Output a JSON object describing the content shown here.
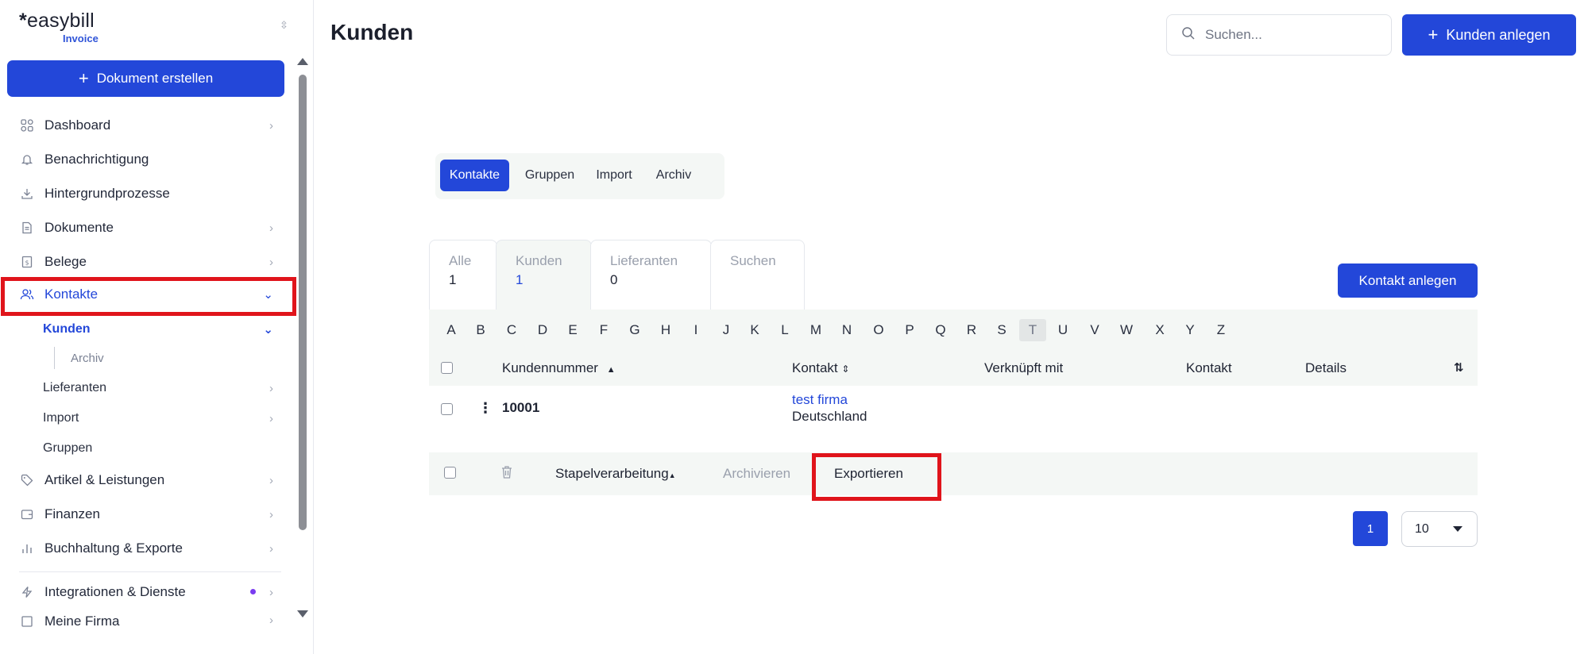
{
  "app": {
    "logo": "easybill",
    "logo_star": "*",
    "logo_sub": "Invoice",
    "collapse_icon": "chevron-up-down"
  },
  "sidebar": {
    "create_button": "Dokument erstellen",
    "items": [
      {
        "label": "Dashboard",
        "icon": "grid-icon"
      },
      {
        "label": "Benachrichtigung",
        "icon": "bell-icon"
      },
      {
        "label": "Hintergrundprozesse",
        "icon": "download-icon"
      },
      {
        "label": "Dokumente",
        "icon": "document-icon"
      },
      {
        "label": "Belege",
        "icon": "receipt-icon"
      },
      {
        "label": "Kontakte",
        "icon": "users-icon"
      },
      {
        "label": "Artikel & Leistungen",
        "icon": "tag-icon"
      },
      {
        "label": "Finanzen",
        "icon": "wallet-icon"
      },
      {
        "label": "Buchhaltung & Exporte",
        "icon": "bar-chart-icon"
      },
      {
        "label": "Integrationen & Dienste",
        "icon": "bolt-icon"
      },
      {
        "label": "Meine Firma",
        "icon": "building-icon"
      }
    ],
    "sub_items": [
      {
        "label": "Kunden"
      },
      {
        "label": "Archiv"
      },
      {
        "label": "Lieferanten"
      },
      {
        "label": "Import"
      },
      {
        "label": "Gruppen"
      }
    ]
  },
  "header": {
    "title": "Kunden",
    "search_placeholder": "Suchen...",
    "add_customer": "Kunden anlegen"
  },
  "segments": [
    "Kontakte",
    "Gruppen",
    "Import",
    "Archiv"
  ],
  "tabs": [
    {
      "label": "Alle",
      "count": "1"
    },
    {
      "label": "Kunden",
      "count": "1"
    },
    {
      "label": "Lieferanten",
      "count": "0"
    },
    {
      "label": "Suchen",
      "count": ""
    }
  ],
  "add_contact": "Kontakt anlegen",
  "letters": [
    "A",
    "B",
    "C",
    "D",
    "E",
    "F",
    "G",
    "H",
    "I",
    "J",
    "K",
    "L",
    "M",
    "N",
    "O",
    "P",
    "Q",
    "R",
    "S",
    "T",
    "U",
    "V",
    "W",
    "X",
    "Y",
    "Z"
  ],
  "active_letter": "T",
  "table": {
    "columns": [
      "Kundennummer",
      "Kontakt",
      "Verknüpft mit",
      "Kontakt",
      "Details"
    ],
    "rows": [
      {
        "number": "10001",
        "contact_name": "test firma",
        "contact_country": "Deutschland"
      }
    ]
  },
  "bulk": {
    "batch": "Stapelverarbeitung",
    "archive": "Archivieren",
    "export": "Exportieren"
  },
  "pagination": {
    "current_page": "1",
    "per_page": "10"
  },
  "colors": {
    "accent": "#2347d9",
    "highlight": "#e0141b",
    "status_dot": "#7a3cf0"
  }
}
